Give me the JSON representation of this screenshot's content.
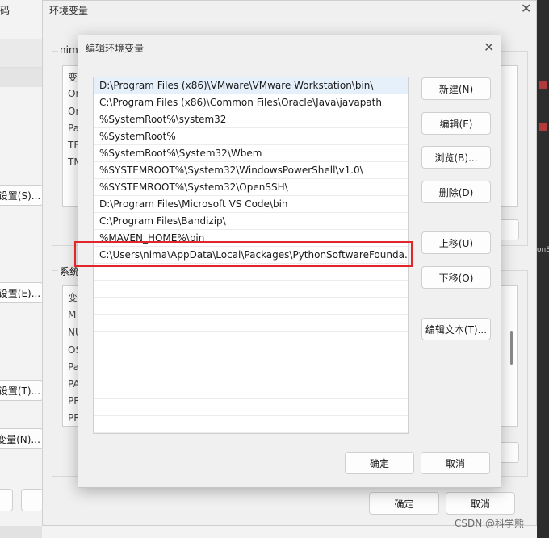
{
  "background": {
    "left_labels": [
      "码",
      "设置(S)...",
      "设置(E)...",
      "设置(T)...",
      "变量(N)..."
    ],
    "right_fragments": [
      "onS"
    ],
    "watermark": "CSDN @科学熊"
  },
  "env_dialog": {
    "title": "环境变量",
    "user_group_label": "nima",
    "user_vars_partial": [
      "变",
      "On",
      "On",
      "Pa",
      "TE",
      "TM"
    ],
    "system_group_label": "系统",
    "system_vars_partial": [
      "变",
      "M",
      "NU",
      "OS",
      "Pa",
      "PA",
      "PR",
      "PR"
    ],
    "ok_label": "确定",
    "cancel_label": "取消"
  },
  "edit_dialog": {
    "title": "编辑环境变量",
    "paths": [
      "D:\\Program Files (x86)\\VMware\\VMware Workstation\\bin\\",
      "C:\\Program Files (x86)\\Common Files\\Oracle\\Java\\javapath",
      "%SystemRoot%\\system32",
      "%SystemRoot%",
      "%SystemRoot%\\System32\\Wbem",
      "%SYSTEMROOT%\\System32\\WindowsPowerShell\\v1.0\\",
      "%SYSTEMROOT%\\System32\\OpenSSH\\",
      "D:\\Program Files\\Microsoft VS Code\\bin",
      "C:\\Program Files\\Bandizip\\",
      "%MAVEN_HOME%\\bin",
      "C:\\Users\\nima\\AppData\\Local\\Packages\\PythonSoftwareFounda..."
    ],
    "buttons": {
      "new": "新建(N)",
      "edit": "编辑(E)",
      "browse": "浏览(B)...",
      "delete": "删除(D)",
      "move_up": "上移(U)",
      "move_down": "下移(O)",
      "edit_text": "编辑文本(T)...",
      "ok": "确定",
      "cancel": "取消"
    },
    "highlight_color": "#e0262a"
  }
}
